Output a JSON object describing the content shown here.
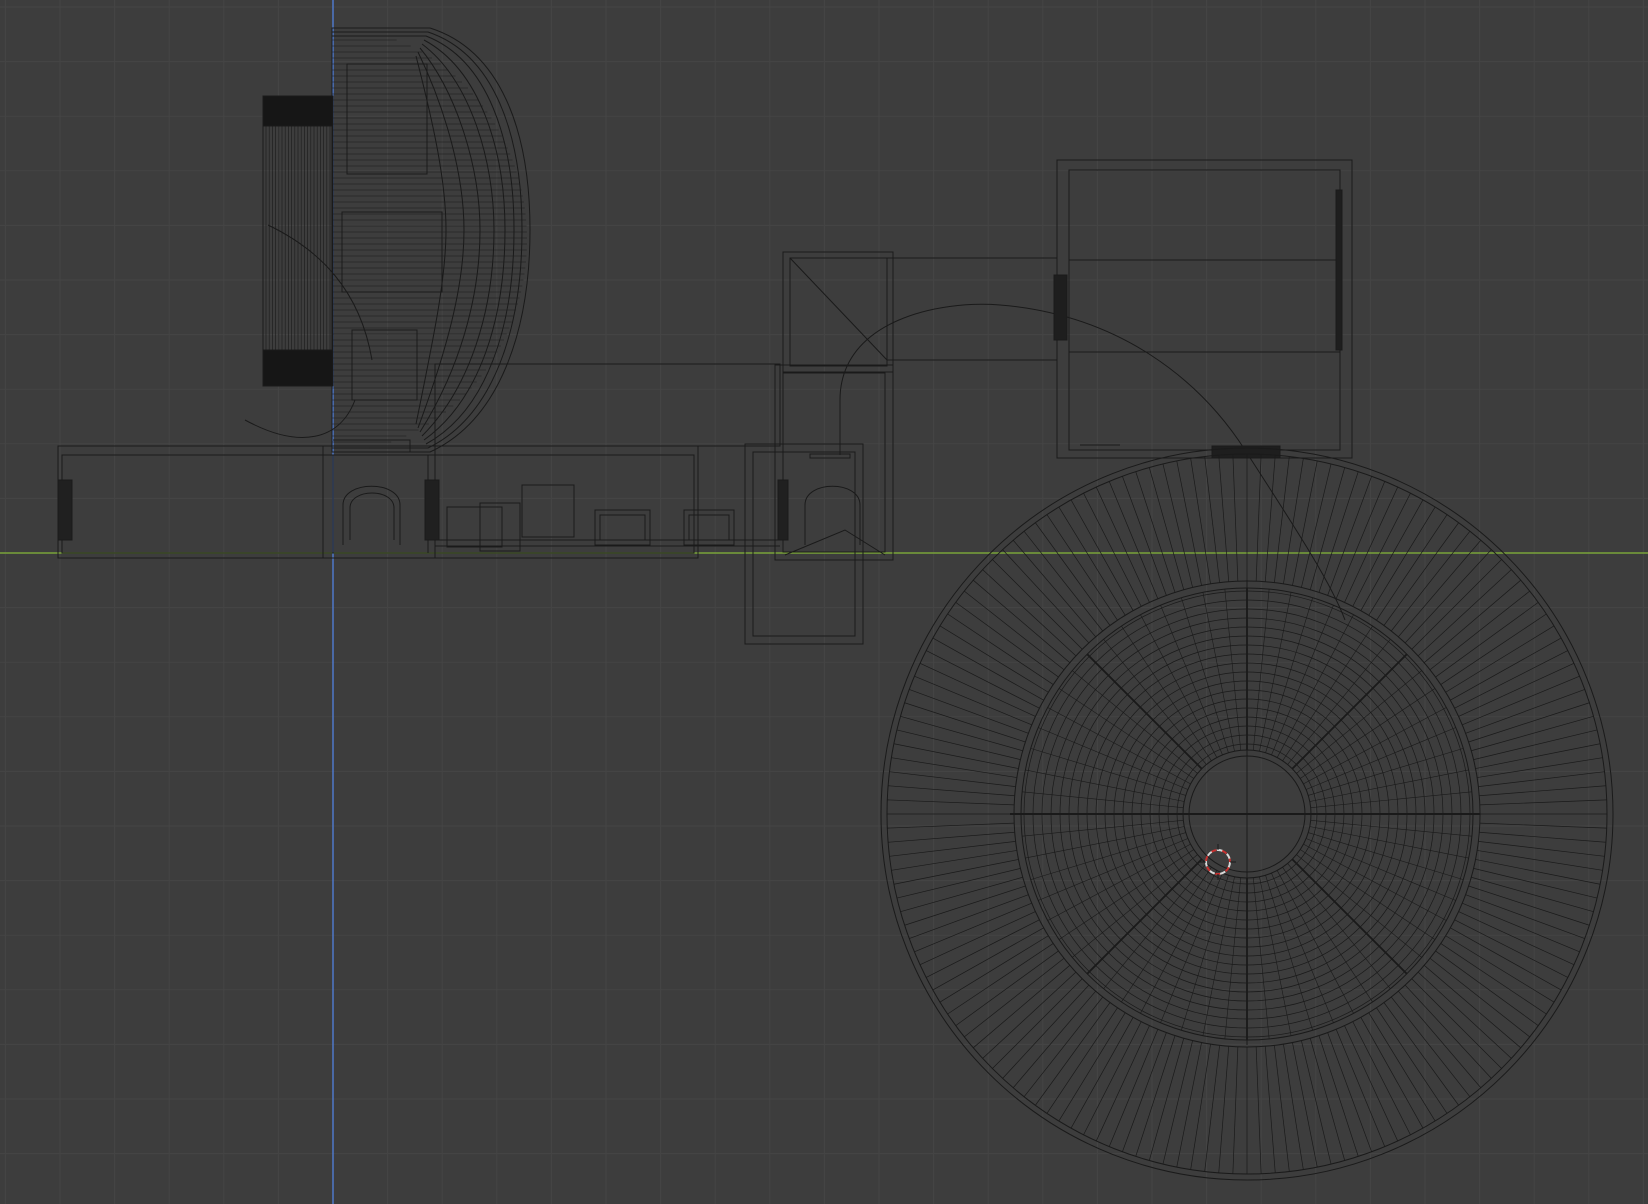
{
  "viewport": {
    "type": "3d-viewport-wireframe-top-view",
    "background_color": "#3d3d3d",
    "grid_minor_color": "#454545",
    "grid_major_color": "#4a4a4a",
    "wire_color": "#1a1a1a",
    "x_axis_color": "#7aa33a",
    "y_axis_color": "#4f78c9",
    "cursor_colors": [
      "#d8d8d8",
      "#c8302f"
    ]
  }
}
